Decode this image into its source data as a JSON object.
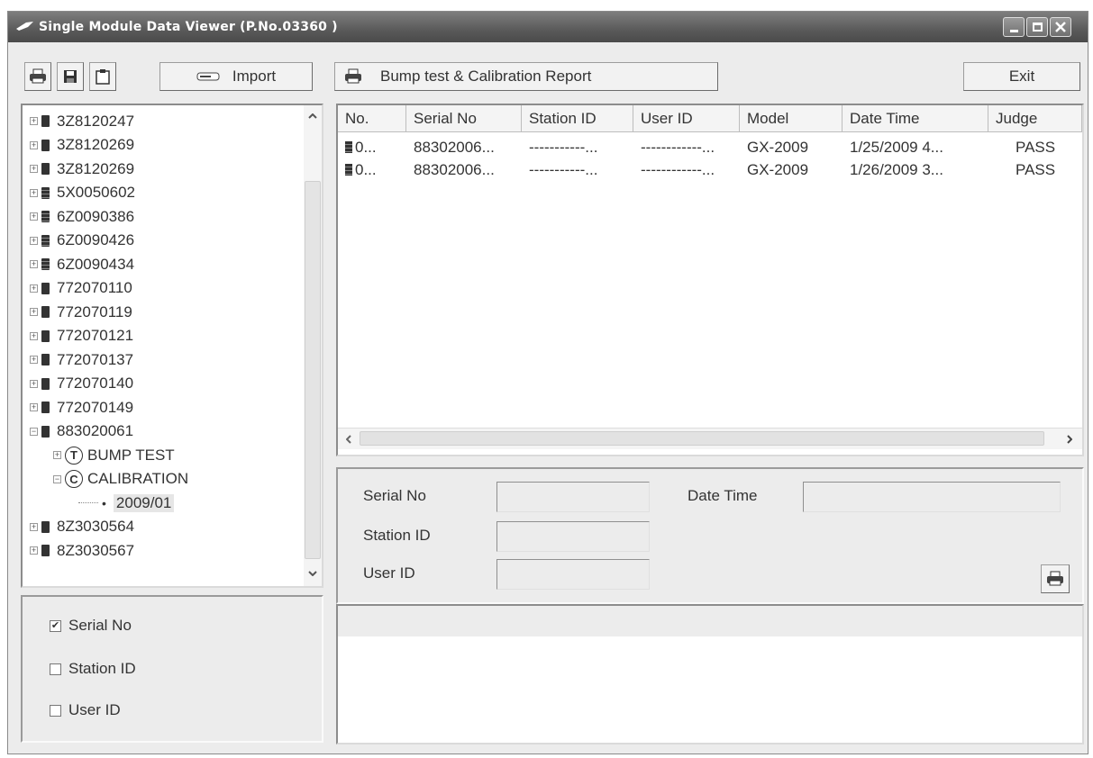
{
  "window": {
    "title": "Single Module Data Viewer (P.No.03360 )"
  },
  "toolbar": {
    "import_label": "Import",
    "report_label": "Bump test & Calibration Report",
    "exit_label": "Exit"
  },
  "tree": {
    "items": [
      {
        "label": "3Z8120247",
        "type": "device"
      },
      {
        "label": "3Z8120269",
        "type": "device"
      },
      {
        "label": "3Z8120269",
        "type": "device"
      },
      {
        "label": "5X0050602",
        "type": "device-alt"
      },
      {
        "label": "6Z0090386",
        "type": "device-alt"
      },
      {
        "label": "6Z0090426",
        "type": "device-alt"
      },
      {
        "label": "6Z0090434",
        "type": "device-alt"
      },
      {
        "label": "772070110",
        "type": "device"
      },
      {
        "label": "772070119",
        "type": "device"
      },
      {
        "label": "772070121",
        "type": "device"
      },
      {
        "label": "772070137",
        "type": "device"
      },
      {
        "label": "772070140",
        "type": "device"
      },
      {
        "label": "772070149",
        "type": "device"
      },
      {
        "label": "883020061",
        "type": "device"
      },
      {
        "label": "BUMP TEST",
        "type": "bump",
        "badge": "T"
      },
      {
        "label": "CALIBRATION",
        "type": "calib",
        "badge": "C"
      },
      {
        "label": "2009/01",
        "type": "leaf"
      },
      {
        "label": "8Z3030564",
        "type": "device"
      },
      {
        "label": "8Z3030567",
        "type": "device"
      }
    ]
  },
  "filters": {
    "serial_no": {
      "label": "Serial No",
      "checked": true
    },
    "station_id": {
      "label": "Station ID",
      "checked": false
    },
    "user_id": {
      "label": "User ID",
      "checked": false
    }
  },
  "table": {
    "columns": [
      "No.",
      "Serial No",
      "Station ID",
      "User ID",
      "Model",
      "Date Time",
      "Judge"
    ],
    "rows": [
      [
        "0...",
        "88302006...",
        "-----------...",
        "------------...",
        "GX-2009",
        "1/25/2009 4...",
        "PASS"
      ],
      [
        "0...",
        "88302006...",
        "-----------...",
        "------------...",
        "GX-2009",
        "1/26/2009 3...",
        "PASS"
      ]
    ]
  },
  "detail": {
    "serial_label": "Serial No",
    "station_label": "Station ID",
    "user_label": "User ID",
    "datetime_label": "Date Time"
  },
  "colors": {
    "title_bar": "#5a5a5a",
    "window_bg": "#ececec"
  }
}
